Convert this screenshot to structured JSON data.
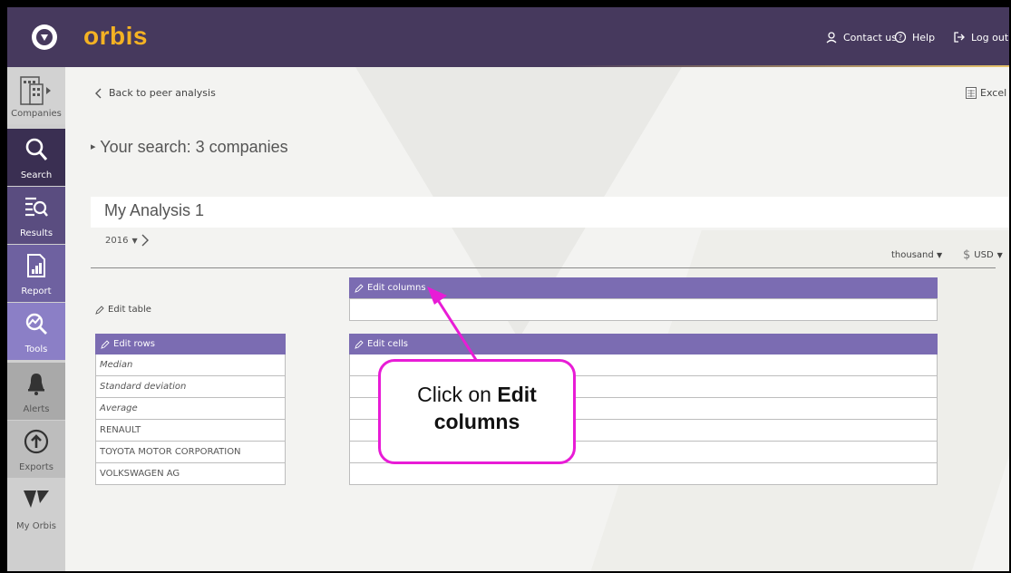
{
  "header": {
    "brand": "orbis",
    "contact": "Contact us",
    "help": "Help",
    "logout": "Log out"
  },
  "sidebar": {
    "items": [
      {
        "label": "Companies",
        "icon": "companies-icon"
      },
      {
        "label": "Search",
        "icon": "search-icon"
      },
      {
        "label": "Results",
        "icon": "results-icon"
      },
      {
        "label": "Report",
        "icon": "report-icon"
      },
      {
        "label": "Tools",
        "icon": "tools-icon"
      },
      {
        "label": "Alerts",
        "icon": "bell-icon"
      },
      {
        "label": "Exports",
        "icon": "export-icon"
      },
      {
        "label": "My Orbis",
        "icon": "my-orbis-icon"
      }
    ]
  },
  "main": {
    "back": "Back to peer analysis",
    "excel": "Excel",
    "search_summary": "Your search: 3 companies",
    "analysis_title": "My Analysis 1",
    "year": "2016",
    "unit": "thousand",
    "currency": "USD",
    "edit_columns": "Edit columns",
    "edit_table": "Edit table",
    "edit_rows": "Edit rows",
    "edit_cells": "Edit cells",
    "rows": [
      {
        "label": "Median",
        "italic": true
      },
      {
        "label": "Standard deviation",
        "italic": true
      },
      {
        "label": "Average",
        "italic": true
      },
      {
        "label": "RENAULT",
        "italic": false
      },
      {
        "label": "TOYOTA MOTOR CORPORATION",
        "italic": false
      },
      {
        "label": "VOLKSWAGEN AG",
        "italic": false
      }
    ]
  },
  "callout": {
    "text_prefix": "Click on ",
    "text_bold": "Edit columns"
  },
  "colors": {
    "header_bg": "#46395d",
    "brand": "#f4b223",
    "table_header": "#7b6cb2",
    "callout_border": "#e81cd6"
  }
}
